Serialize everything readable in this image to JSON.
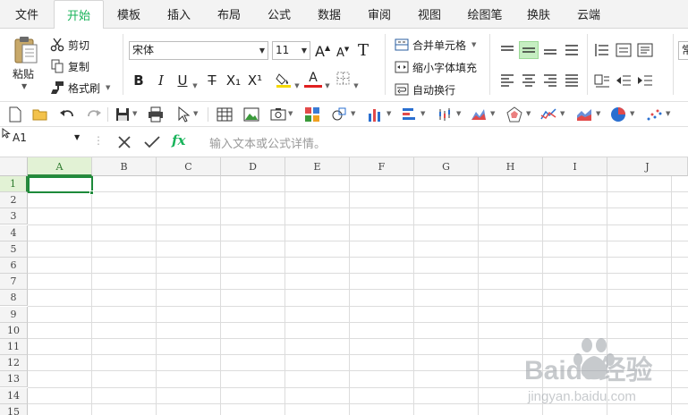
{
  "menu": {
    "tabs": [
      {
        "label": "文件"
      },
      {
        "label": "开始"
      },
      {
        "label": "模板"
      },
      {
        "label": "插入"
      },
      {
        "label": "布局"
      },
      {
        "label": "公式"
      },
      {
        "label": "数据"
      },
      {
        "label": "审阅"
      },
      {
        "label": "视图"
      },
      {
        "label": "绘图笔"
      },
      {
        "label": "换肤"
      },
      {
        "label": "云端"
      }
    ],
    "active_tab": "开始"
  },
  "ribbon": {
    "clipboard": {
      "paste": "粘贴",
      "cut": "剪切",
      "copy": "复制",
      "format_painter": "格式刷"
    },
    "font": {
      "family": "宋体",
      "size": "11",
      "bold": "B",
      "italic": "I",
      "underline": "U",
      "strikethrough": "T",
      "subscript": "X₁",
      "superscript": "X¹",
      "grow": "A",
      "shrink": "A",
      "clear": "T",
      "font_color_letter": "A"
    },
    "merge": {
      "merge_center": "合并单元格",
      "shrink_fit": "缩小字体填充",
      "wrap_text": "自动换行"
    },
    "number_format_partial": "常"
  },
  "formula_bar": {
    "cell_ref": "A1",
    "placeholder": "输入文本或公式详情。",
    "fx": "fx"
  },
  "grid": {
    "columns": [
      "A",
      "B",
      "C",
      "D",
      "E",
      "F",
      "G",
      "H",
      "I",
      "J"
    ],
    "rows": [
      "1",
      "2",
      "3",
      "4",
      "5",
      "6",
      "7",
      "8",
      "9",
      "10",
      "11",
      "12",
      "13",
      "14",
      "15"
    ],
    "selected_cell": "A1"
  },
  "watermark": {
    "brand": "Baidu经验",
    "url": "jingyan.baidu.com"
  },
  "colors": {
    "accent_green": "#18b35a",
    "selection_green": "#1d8a3a",
    "header_selected": "#e2f2d5",
    "font_color_red": "#e02020",
    "highlight_yellow": "#f5d800"
  }
}
